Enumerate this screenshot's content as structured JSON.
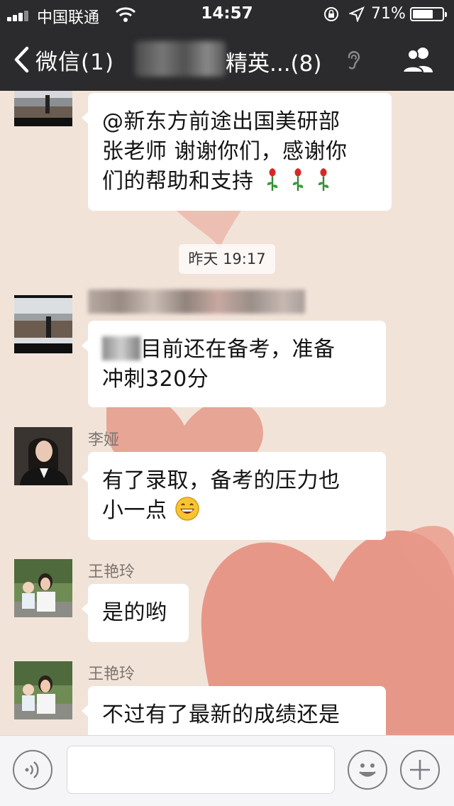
{
  "status_bar": {
    "carrier": "中国联通",
    "time": "14:57",
    "battery": "71%",
    "battery_level": 0.71
  },
  "nav": {
    "back_label": "微信(1)",
    "title": "精英...(8)",
    "icons": [
      "chevron-left-icon",
      "ear-icon",
      "group-members-icon"
    ]
  },
  "chat": {
    "messages": [
      {
        "text": "@新东方前途出国美研部张老师 谢谢你们，感谢你们的帮助和支持",
        "emoji": "rose ×3"
      },
      {
        "timestamp": "昨天 19:17"
      },
      {
        "text": "目前还在备考，准备冲刺320分"
      },
      {
        "sender": "李娅",
        "text": "有了录取，备考的压力也小一点",
        "emoji": "grinning-face"
      },
      {
        "sender": "王艳玲",
        "text": "是的哟"
      },
      {
        "sender": "王艳玲",
        "text": "不过有了最新的成绩还是"
      }
    ],
    "m1_line1": "@新东方前途出国美研部",
    "m1_line2": "张老师 谢谢你们，感谢你",
    "m1_line3": "们的帮助和支持",
    "ts": "昨天 19:17",
    "m2_line1": "目前还在备考，准备",
    "m2_line2": "冲刺320分",
    "m3_sender": "李娅",
    "m3_line1": "有了录取，备考的压力也",
    "m3_line2": "小一点",
    "m4_sender": "王艳玲",
    "m4_line1": "是的哟",
    "m5_sender": "王艳玲",
    "m5_line1": "不过有了最新的成绩还是"
  },
  "input_bar": {
    "icons": [
      "voice-icon",
      "emoji-icon",
      "plus-icon"
    ],
    "text": ""
  },
  "colors": {
    "nav_bg": "#2b2b2d",
    "chat_bg": "#f2e3d8",
    "bubble": "#ffffff",
    "heart": "#e58f80"
  }
}
